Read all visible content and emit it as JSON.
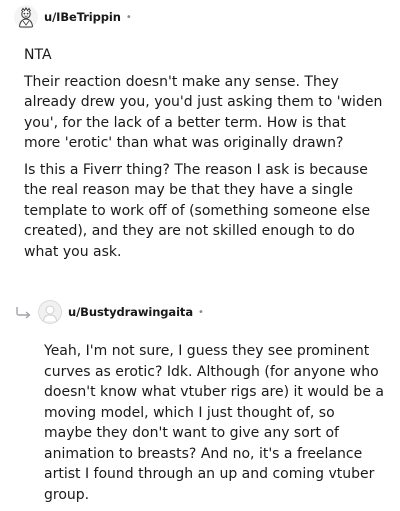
{
  "comments": [
    {
      "username": "u/IBeTrippin",
      "separator": "•",
      "avatar_icon": "user-avatar-icon",
      "paragraphs": [
        "NTA",
        "Their reaction doesn't make any sense. They already drew you, you'd just asking them to 'widen you', for the lack of a better term. How is that more 'erotic' than what was originally drawn?",
        "Is this a Fiverr thing? The reason I ask is because the real reason may be that they have a single template to work off of (something someone else created), and they are not skilled enough to do what you ask."
      ]
    },
    {
      "username": "u/Bustydrawingaita",
      "separator": "•",
      "avatar_icon": "user-avatar-icon",
      "reply_icon": "reply-arrow-icon",
      "paragraphs": [
        "Yeah, I'm not sure, I guess they see prominent curves as erotic? Idk. Although (for anyone who doesn't know what vtuber rigs are) it would be a moving model, which I just thought of, so maybe they don't want to give any sort of animation to breasts? And no, it's a freelance artist I found through an up and coming vtuber group."
      ]
    }
  ]
}
